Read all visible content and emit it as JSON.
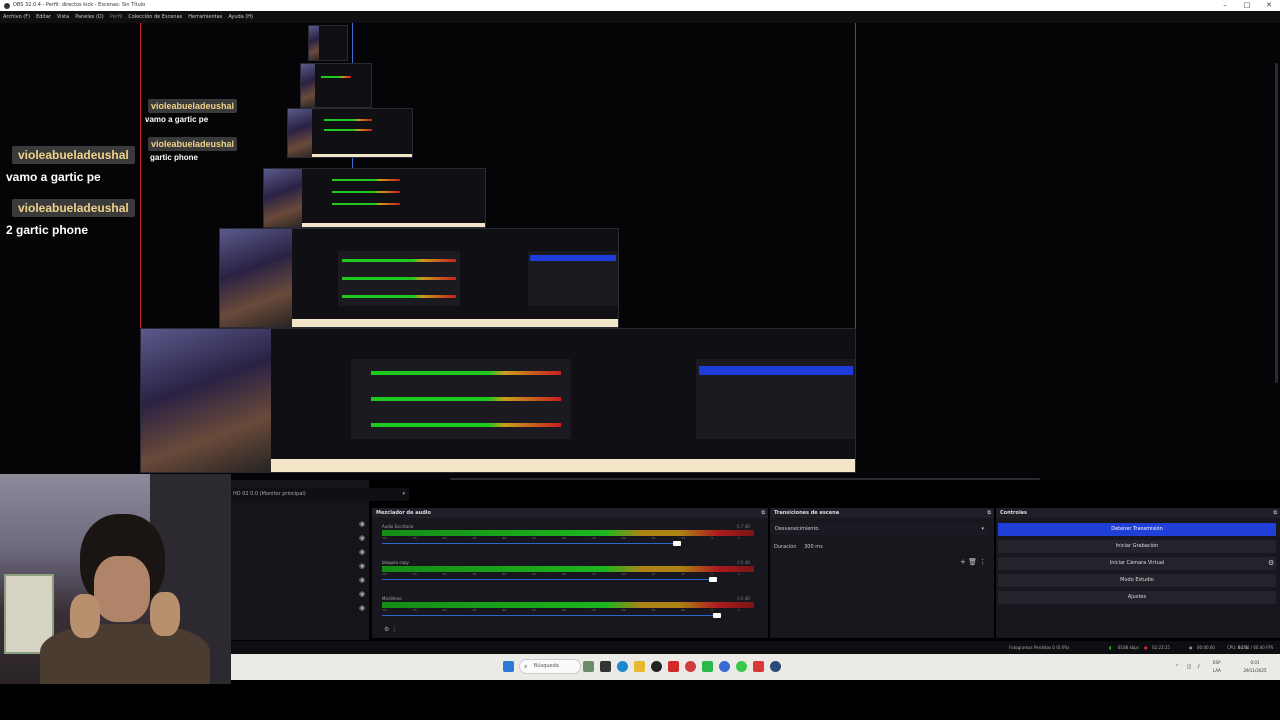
{
  "window": {
    "title": "OBS 32.0.4 - Perfil: directos kick - Escenas: Sin Título",
    "controls": [
      "–",
      "□",
      "✕"
    ]
  },
  "menu": [
    "Archivo (F)",
    "Editar",
    "Vista",
    "Paneles (D)",
    "Perfil",
    "Colección de Escenas",
    "Herramientas",
    "Ayuda (H)"
  ],
  "chat": [
    {
      "user": "violeabueladeushal",
      "message": "vamo a gartic pe"
    },
    {
      "user": "violeabueladeushal",
      "message": "2 gartic phone"
    }
  ],
  "nested_chat": [
    {
      "user": "violeabueladeushal",
      "message": "vamo a gartic pe"
    },
    {
      "user": "violeabueladeushal",
      "message": "gartic phone"
    }
  ],
  "scene_select": "HD 02 0.0 (Monitor principal)",
  "mixer": {
    "title": "Mezclador de audio",
    "tracks": [
      {
        "name": "Audio Escritorio",
        "db": "-5.7 dB",
        "level": 0.68,
        "volume": 0.82
      },
      {
        "name": "bloqueo copy",
        "db": "0.0 dB",
        "level": 0.66,
        "volume": 0.92
      },
      {
        "name": "Micrófono",
        "db": "0.0 dB",
        "level": 0.66,
        "volume": 0.93
      }
    ],
    "ticks": [
      "-60",
      "-55",
      "-50",
      "-45",
      "-40",
      "-35",
      "-30",
      "-25",
      "-20",
      "-15",
      "-10",
      "-5",
      "0"
    ]
  },
  "transitions": {
    "title": "Transiciones de escena",
    "selected": "Desvanecimiento",
    "duration_label": "Duración",
    "duration_value": "300 ms"
  },
  "controls": {
    "title": "Controles",
    "buttons": [
      "Detener Transmisión",
      "Iniciar Grabación",
      "Iniciar Cámara Virtual",
      "Modo Estudio",
      "Ajustes"
    ]
  },
  "status": {
    "dropped": "Fotogramas Perdidos 0 (0.0%)",
    "bitrate": "8188 kbps",
    "live_time": "02:23:15",
    "rec_time": "00:00:00",
    "cpu": "CPU: 8.1%",
    "fps": "60.00 / 60.00 FPS"
  },
  "taskbar": {
    "search": "Búsqueda",
    "lang": "ESP LAA",
    "time": "0:01",
    "date": "29/11/2025"
  },
  "colors": {
    "accent": "#1f3fd6",
    "live": "#e03030"
  }
}
